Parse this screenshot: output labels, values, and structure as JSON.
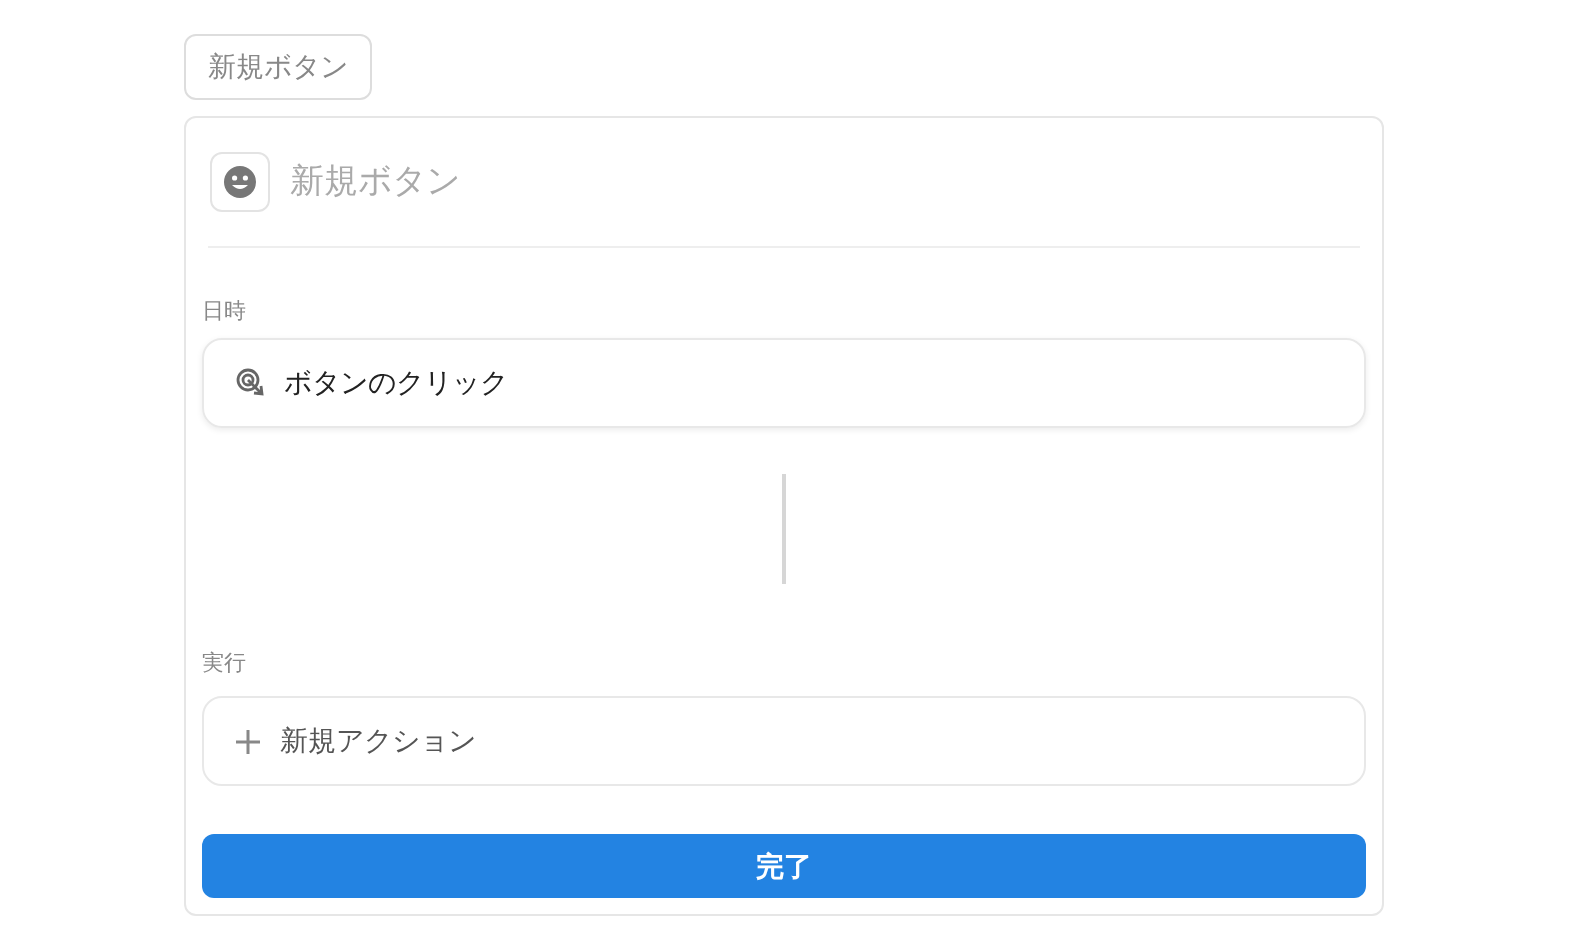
{
  "tag_button": {
    "label": "新規ボタン"
  },
  "name_field": {
    "placeholder": "新規ボタン"
  },
  "trigger_section": {
    "label": "日時",
    "trigger": "ボタンのクリック"
  },
  "action_section": {
    "label": "実行",
    "add_action": "新規アクション"
  },
  "done_button": {
    "label": "完了"
  }
}
